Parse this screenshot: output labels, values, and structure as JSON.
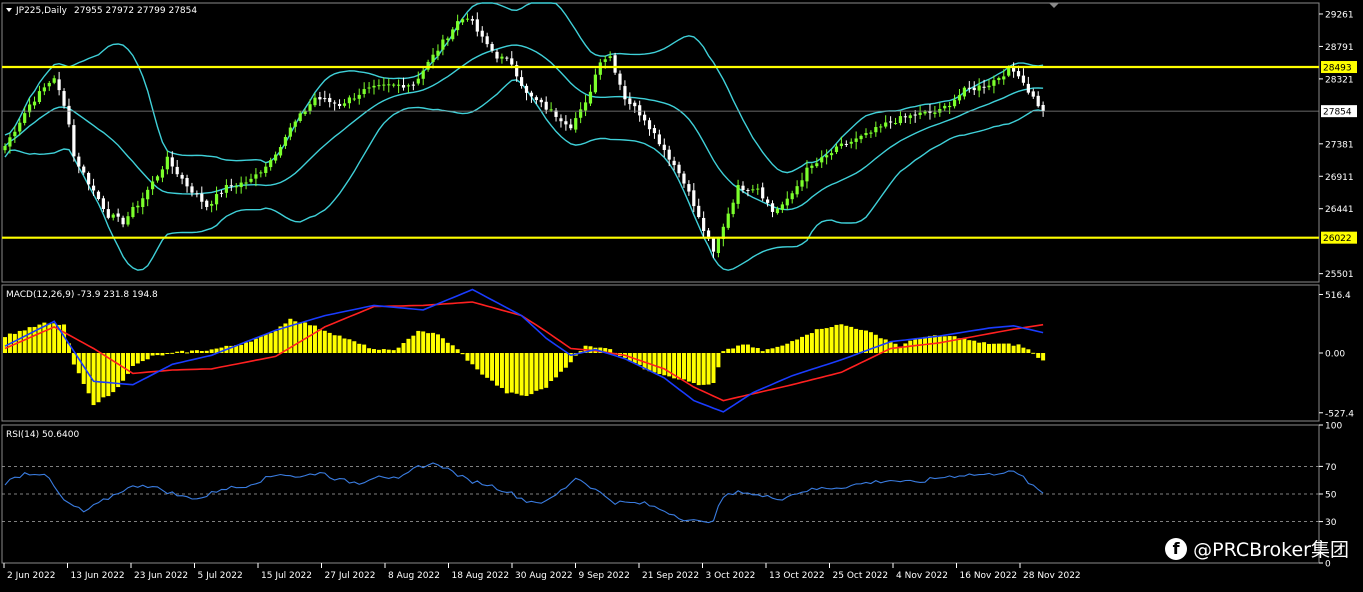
{
  "header": {
    "symbol": "JP225,Daily",
    "ohlc": "27955 27972 27799 27854"
  },
  "watermark": {
    "text": "@PRCBroker集团",
    "icon": "facebook-icon"
  },
  "colors": {
    "background": "#000000",
    "grid_border": "#8a8a8a",
    "bull_candle": "#7cff2c",
    "bear_candle": "#ffffff",
    "bollinger": "#3fd0d8",
    "level_line": "#ffff00",
    "macd_hist": "#ffff00",
    "macd_line": "#1a3cff",
    "signal_line": "#ff2020",
    "rsi_line": "#3a7ce0"
  },
  "chart_data": [
    {
      "type": "candlestick",
      "name": "price",
      "y_ticks": [
        "29261",
        "28791",
        "28321",
        "27381",
        "26911",
        "26441",
        "25501"
      ],
      "ylim": [
        25380,
        29420
      ],
      "horizontal_levels": [
        {
          "label": "28493",
          "value": 28493
        },
        {
          "label": "26022",
          "value": 26022
        }
      ],
      "current_price": {
        "label": "27854",
        "value": 27854
      },
      "indicators": [
        "Bollinger Bands"
      ],
      "close_keypoints": [
        [
          0,
          27350
        ],
        [
          5,
          27950
        ],
        [
          10,
          28350
        ],
        [
          13,
          27700
        ],
        [
          14,
          27200
        ],
        [
          18,
          26700
        ],
        [
          21,
          26350
        ],
        [
          24,
          26250
        ],
        [
          28,
          26600
        ],
        [
          33,
          27150
        ],
        [
          37,
          26780
        ],
        [
          41,
          26480
        ],
        [
          45,
          26750
        ],
        [
          50,
          26850
        ],
        [
          54,
          27150
        ],
        [
          58,
          27600
        ],
        [
          63,
          28050
        ],
        [
          68,
          27950
        ],
        [
          73,
          28150
        ],
        [
          78,
          28220
        ],
        [
          83,
          28250
        ],
        [
          88,
          28750
        ],
        [
          92,
          29150
        ],
        [
          94,
          29230
        ],
        [
          97,
          28900
        ],
        [
          100,
          28650
        ],
        [
          103,
          28550
        ],
        [
          106,
          28100
        ],
        [
          111,
          27850
        ],
        [
          115,
          27650
        ],
        [
          118,
          27950
        ],
        [
          121,
          28600
        ],
        [
          123,
          28650
        ],
        [
          126,
          28050
        ],
        [
          130,
          27750
        ],
        [
          134,
          27300
        ],
        [
          138,
          26850
        ],
        [
          141,
          26300
        ],
        [
          144,
          25800
        ],
        [
          146,
          26200
        ],
        [
          149,
          26750
        ],
        [
          153,
          26750
        ],
        [
          156,
          26400
        ],
        [
          159,
          26550
        ],
        [
          163,
          27000
        ],
        [
          166,
          27150
        ],
        [
          170,
          27350
        ],
        [
          175,
          27500
        ],
        [
          180,
          27700
        ],
        [
          185,
          27800
        ],
        [
          190,
          27850
        ],
        [
          195,
          28150
        ],
        [
          200,
          28250
        ],
        [
          204,
          28450
        ],
        [
          206,
          28400
        ],
        [
          208,
          28150
        ],
        [
          210,
          27950
        ],
        [
          211,
          27854
        ]
      ]
    },
    {
      "type": "line",
      "name": "MACD",
      "label": "MACD(12,26,9) -73.9 231.8 194.8",
      "y_ticks": [
        "516.4",
        "0.00",
        "-527.4"
      ],
      "ylim": [
        -600,
        600
      ],
      "series": [
        {
          "name": "macd",
          "keypoints": [
            [
              0,
              60
            ],
            [
              10,
              280
            ],
            [
              18,
              -250
            ],
            [
              26,
              -280
            ],
            [
              34,
              -100
            ],
            [
              42,
              -20
            ],
            [
              55,
              200
            ],
            [
              65,
              330
            ],
            [
              75,
              420
            ],
            [
              85,
              380
            ],
            [
              95,
              560
            ],
            [
              105,
              330
            ],
            [
              110,
              130
            ],
            [
              115,
              -20
            ],
            [
              120,
              30
            ],
            [
              126,
              -50
            ],
            [
              134,
              -220
            ],
            [
              140,
              -420
            ],
            [
              146,
              -520
            ],
            [
              152,
              -350
            ],
            [
              160,
              -200
            ],
            [
              170,
              -60
            ],
            [
              180,
              100
            ],
            [
              190,
              150
            ],
            [
              200,
              220
            ],
            [
              205,
              240
            ],
            [
              211,
              180
            ]
          ]
        },
        {
          "name": "signal",
          "keypoints": [
            [
              0,
              40
            ],
            [
              10,
              230
            ],
            [
              18,
              40
            ],
            [
              26,
              -180
            ],
            [
              34,
              -150
            ],
            [
              42,
              -140
            ],
            [
              55,
              -30
            ],
            [
              65,
              230
            ],
            [
              75,
              410
            ],
            [
              85,
              420
            ],
            [
              95,
              450
            ],
            [
              105,
              330
            ],
            [
              110,
              190
            ],
            [
              115,
              40
            ],
            [
              120,
              20
            ],
            [
              126,
              -20
            ],
            [
              134,
              -140
            ],
            [
              140,
              -300
            ],
            [
              146,
              -420
            ],
            [
              152,
              -360
            ],
            [
              160,
              -280
            ],
            [
              170,
              -170
            ],
            [
              180,
              40
            ],
            [
              190,
              90
            ],
            [
              200,
              170
            ],
            [
              205,
              210
            ],
            [
              211,
              250
            ]
          ]
        },
        {
          "name": "histogram",
          "keypoints": [
            [
              0,
              150
            ],
            [
              8,
              260
            ],
            [
              12,
              250
            ],
            [
              14,
              -100
            ],
            [
              18,
              -450
            ],
            [
              22,
              -350
            ],
            [
              26,
              -120
            ],
            [
              30,
              -30
            ],
            [
              36,
              10
            ],
            [
              42,
              30
            ],
            [
              48,
              80
            ],
            [
              54,
              170
            ],
            [
              58,
              300
            ],
            [
              62,
              250
            ],
            [
              68,
              150
            ],
            [
              72,
              80
            ],
            [
              76,
              20
            ],
            [
              80,
              40
            ],
            [
              84,
              200
            ],
            [
              88,
              160
            ],
            [
              92,
              30
            ],
            [
              96,
              -150
            ],
            [
              102,
              -350
            ],
            [
              106,
              -380
            ],
            [
              110,
              -300
            ],
            [
              114,
              -120
            ],
            [
              118,
              60
            ],
            [
              122,
              50
            ],
            [
              126,
              -40
            ],
            [
              130,
              -140
            ],
            [
              134,
              -190
            ],
            [
              138,
              -240
            ],
            [
              142,
              -290
            ],
            [
              144,
              -270
            ],
            [
              146,
              10
            ],
            [
              150,
              80
            ],
            [
              154,
              20
            ],
            [
              158,
              60
            ],
            [
              162,
              150
            ],
            [
              166,
              220
            ],
            [
              170,
              250
            ],
            [
              174,
              210
            ],
            [
              178,
              140
            ],
            [
              182,
              60
            ],
            [
              186,
              140
            ],
            [
              190,
              150
            ],
            [
              194,
              140
            ],
            [
              198,
              90
            ],
            [
              202,
              80
            ],
            [
              206,
              70
            ],
            [
              208,
              30
            ],
            [
              211,
              -70
            ]
          ]
        }
      ]
    },
    {
      "type": "line",
      "name": "RSI",
      "label": "RSI(14) 50.6400",
      "y_ticks": [
        "100",
        "70",
        "50",
        "30",
        "0"
      ],
      "ylim": [
        0,
        100
      ],
      "levels": [
        70,
        50,
        30
      ],
      "keypoints": [
        [
          0,
          58
        ],
        [
          4,
          65
        ],
        [
          8,
          65
        ],
        [
          12,
          45
        ],
        [
          16,
          37
        ],
        [
          20,
          45
        ],
        [
          24,
          53
        ],
        [
          28,
          57
        ],
        [
          32,
          53
        ],
        [
          36,
          48
        ],
        [
          40,
          47
        ],
        [
          44,
          54
        ],
        [
          48,
          55
        ],
        [
          52,
          60
        ],
        [
          56,
          65
        ],
        [
          60,
          62
        ],
        [
          64,
          66
        ],
        [
          68,
          60
        ],
        [
          72,
          58
        ],
        [
          76,
          64
        ],
        [
          80,
          60
        ],
        [
          84,
          70
        ],
        [
          88,
          72
        ],
        [
          90,
          68
        ],
        [
          94,
          60
        ],
        [
          98,
          57
        ],
        [
          102,
          52
        ],
        [
          106,
          45
        ],
        [
          110,
          44
        ],
        [
          114,
          55
        ],
        [
          116,
          62
        ],
        [
          118,
          58
        ],
        [
          120,
          53
        ],
        [
          124,
          44
        ],
        [
          130,
          43
        ],
        [
          134,
          38
        ],
        [
          138,
          32
        ],
        [
          142,
          29
        ],
        [
          144,
          32
        ],
        [
          146,
          48
        ],
        [
          150,
          52
        ],
        [
          154,
          48
        ],
        [
          158,
          47
        ],
        [
          162,
          52
        ],
        [
          166,
          54
        ],
        [
          170,
          55
        ],
        [
          175,
          58
        ],
        [
          180,
          60
        ],
        [
          185,
          58
        ],
        [
          190,
          62
        ],
        [
          195,
          64
        ],
        [
          200,
          64
        ],
        [
          204,
          67
        ],
        [
          207,
          62
        ],
        [
          209,
          55
        ],
        [
          211,
          50.64
        ]
      ]
    }
  ],
  "x_axis": {
    "dates": [
      "2 Jun 2022",
      "13 Jun 2022",
      "23 Jun 2022",
      "5 Jul 2022",
      "15 Jul 2022",
      "27 Jul 2022",
      "8 Aug 2022",
      "18 Aug 2022",
      "30 Aug 2022",
      "9 Sep 2022",
      "21 Sep 2022",
      "3 Oct 2022",
      "13 Oct 2022",
      "25 Oct 2022",
      "4 Nov 2022",
      "16 Nov 2022",
      "28 Nov 2022"
    ]
  }
}
